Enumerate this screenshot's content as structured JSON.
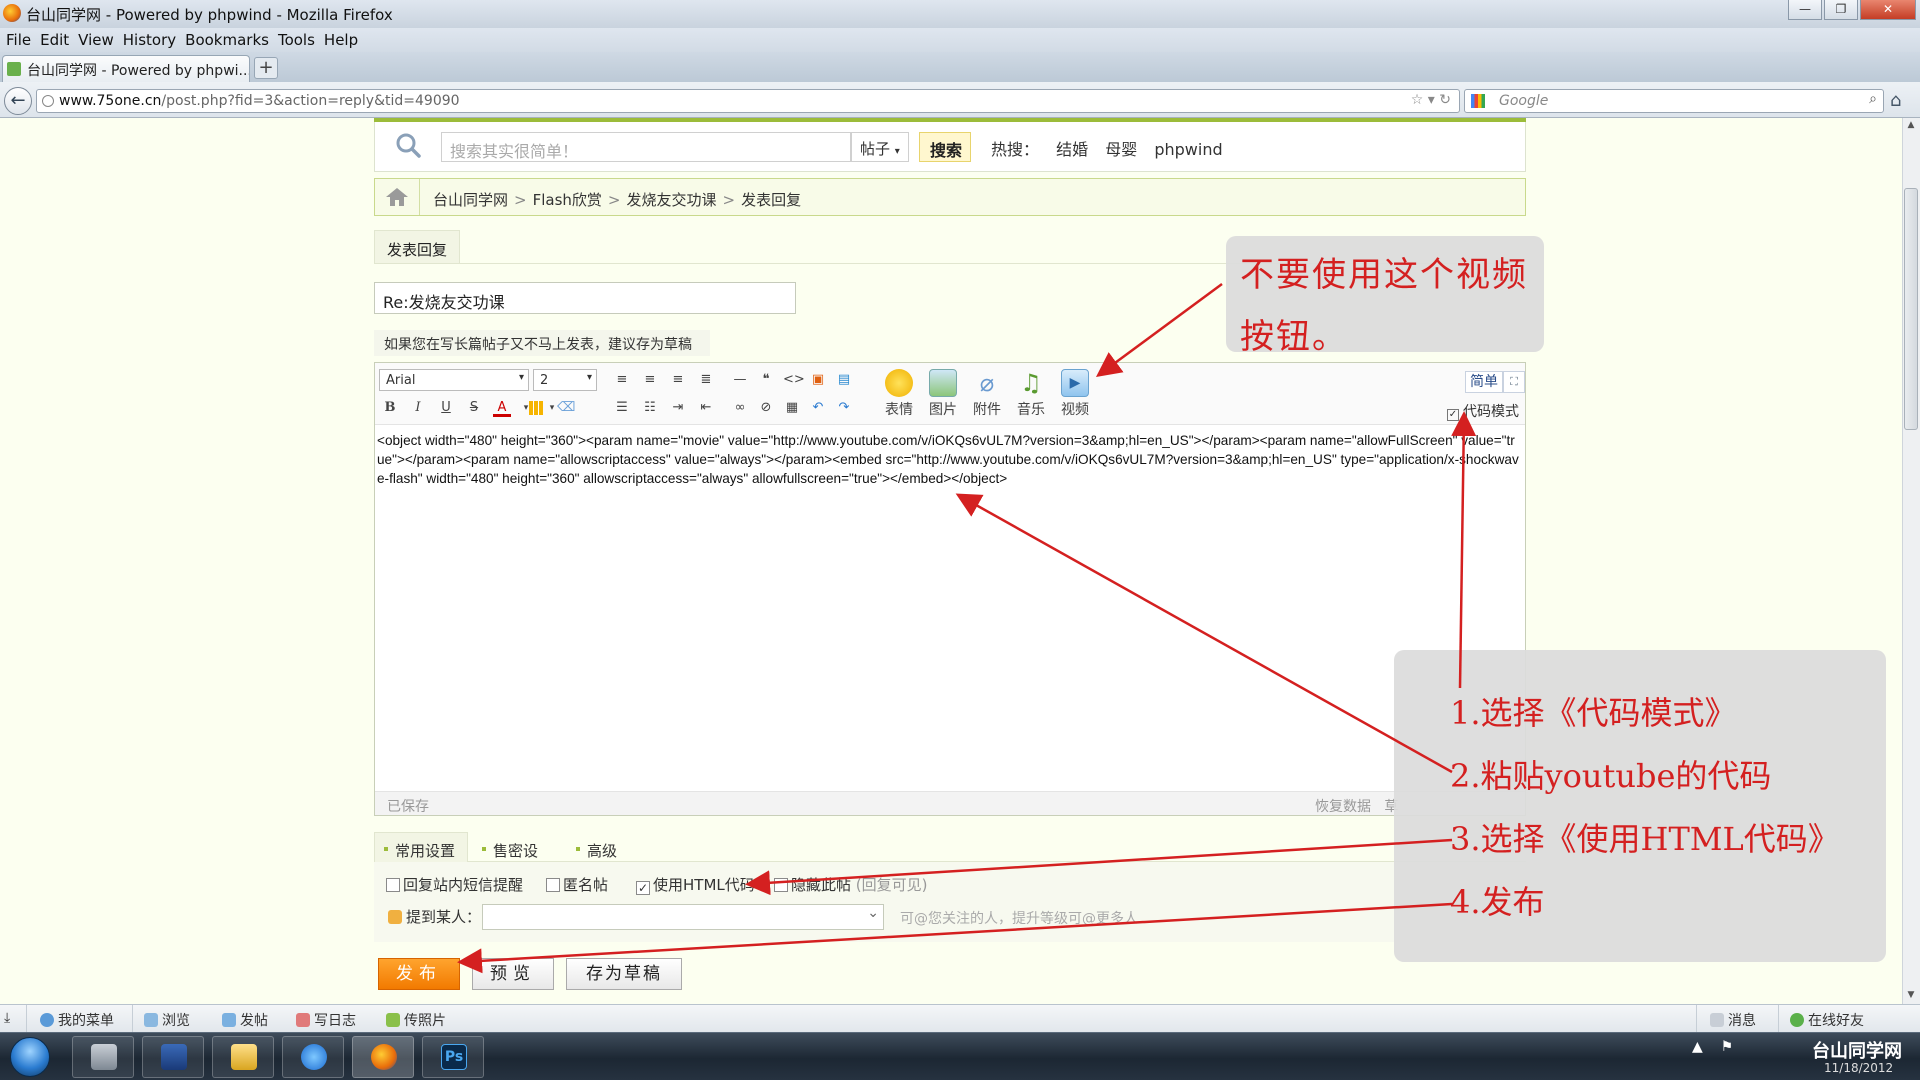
{
  "browser": {
    "window_title": "台山同学网 - Powered by phpwind - Mozilla Firefox",
    "menu": [
      "File",
      "Edit",
      "View",
      "History",
      "Bookmarks",
      "Tools",
      "Help"
    ],
    "tab_title": "台山同学网 - Powered by phpwi...",
    "new_tab": "+",
    "url_domain": "www.75one.cn",
    "url_path": "/post.php?fid=3&action=reply&tid=49090",
    "search_placeholder": "Google",
    "icons": [
      "firefox-logo-icon",
      "back-arrow-icon",
      "bookmark-star-icon",
      "reload-icon",
      "google-icon",
      "search-icon",
      "home-icon"
    ]
  },
  "site_search": {
    "placeholder": "搜索其实很简单！",
    "type_label": "帖子",
    "button": "搜索",
    "hot_label": "热搜：",
    "hot_terms": [
      "结婚",
      "母婴",
      "phpwind"
    ]
  },
  "breadcrumb": [
    "台山同学网",
    "Flash欣赏",
    "发烧友交功课",
    "发表回复"
  ],
  "reply_tab": "发表回复",
  "subject_value": "Re:发烧友交功课",
  "draft_note": "如果您在写长篇帖子又不马上发表，建议存为草稿",
  "editor": {
    "font": "Arial",
    "size": "2",
    "media_buttons": [
      "表情",
      "图片",
      "附件",
      "音乐",
      "视频"
    ],
    "simple_button": "简单",
    "code_mode_label": "代码模式",
    "code_mode_checked": true,
    "content": "<object width=\"480\" height=\"360\"><param name=\"movie\" value=\"http://www.youtube.com/v/iOKQs6vUL7M?version=3&amp;hl=en_US\"></param><param name=\"allowFullScreen\" value=\"true\"></param><param name=\"allowscriptaccess\" value=\"always\"></param><embed src=\"http://www.youtube.com/v/iOKQs6vUL7M?version=3&amp;hl=en_US\" type=\"application/x-shockwave-flash\" width=\"480\" height=\"360\" allowscriptaccess=\"always\" allowfullscreen=\"true\"></embed></object>",
    "saved_status": "已保存",
    "restore_label": "恢复数据",
    "restore_tail": "草"
  },
  "settings": {
    "tabs": [
      "常用设置",
      "售密设置",
      "高级"
    ],
    "options": [
      {
        "label": "回复站内短信提醒",
        "checked": false
      },
      {
        "label": "匿名帖",
        "checked": false
      },
      {
        "label": "使用HTML代码",
        "checked": true
      },
      {
        "label": "隐藏此帖",
        "checked": false,
        "note": "(回复可见)"
      }
    ],
    "mention_label": "提到某人：",
    "mention_hint": "可@您关注的人，提升等级可@更多人"
  },
  "buttons": {
    "publish": "发布",
    "preview": "预览",
    "save_draft": "存为草稿"
  },
  "site_bar": {
    "left": [
      "我的菜单",
      "浏览",
      "发帖",
      "写日志",
      "传照片"
    ],
    "right": [
      "消息",
      "在线好友"
    ]
  },
  "taskbar": {
    "apps": [
      "file-manager-icon",
      "powershell-icon",
      "explorer-folder-icon",
      "internet-explorer-icon",
      "firefox-icon",
      "photoshop-icon"
    ],
    "ps_label": "Ps",
    "brand": "台山同学网",
    "date": "11/18/2012"
  },
  "annotations": {
    "warning": "不要使用这个视频按钮。",
    "steps": [
      "1.选择《代码模式》",
      "2.粘贴youtube的代码",
      "3.选择《使用HTML代码》",
      "4.发布"
    ],
    "color": "#d42020"
  }
}
